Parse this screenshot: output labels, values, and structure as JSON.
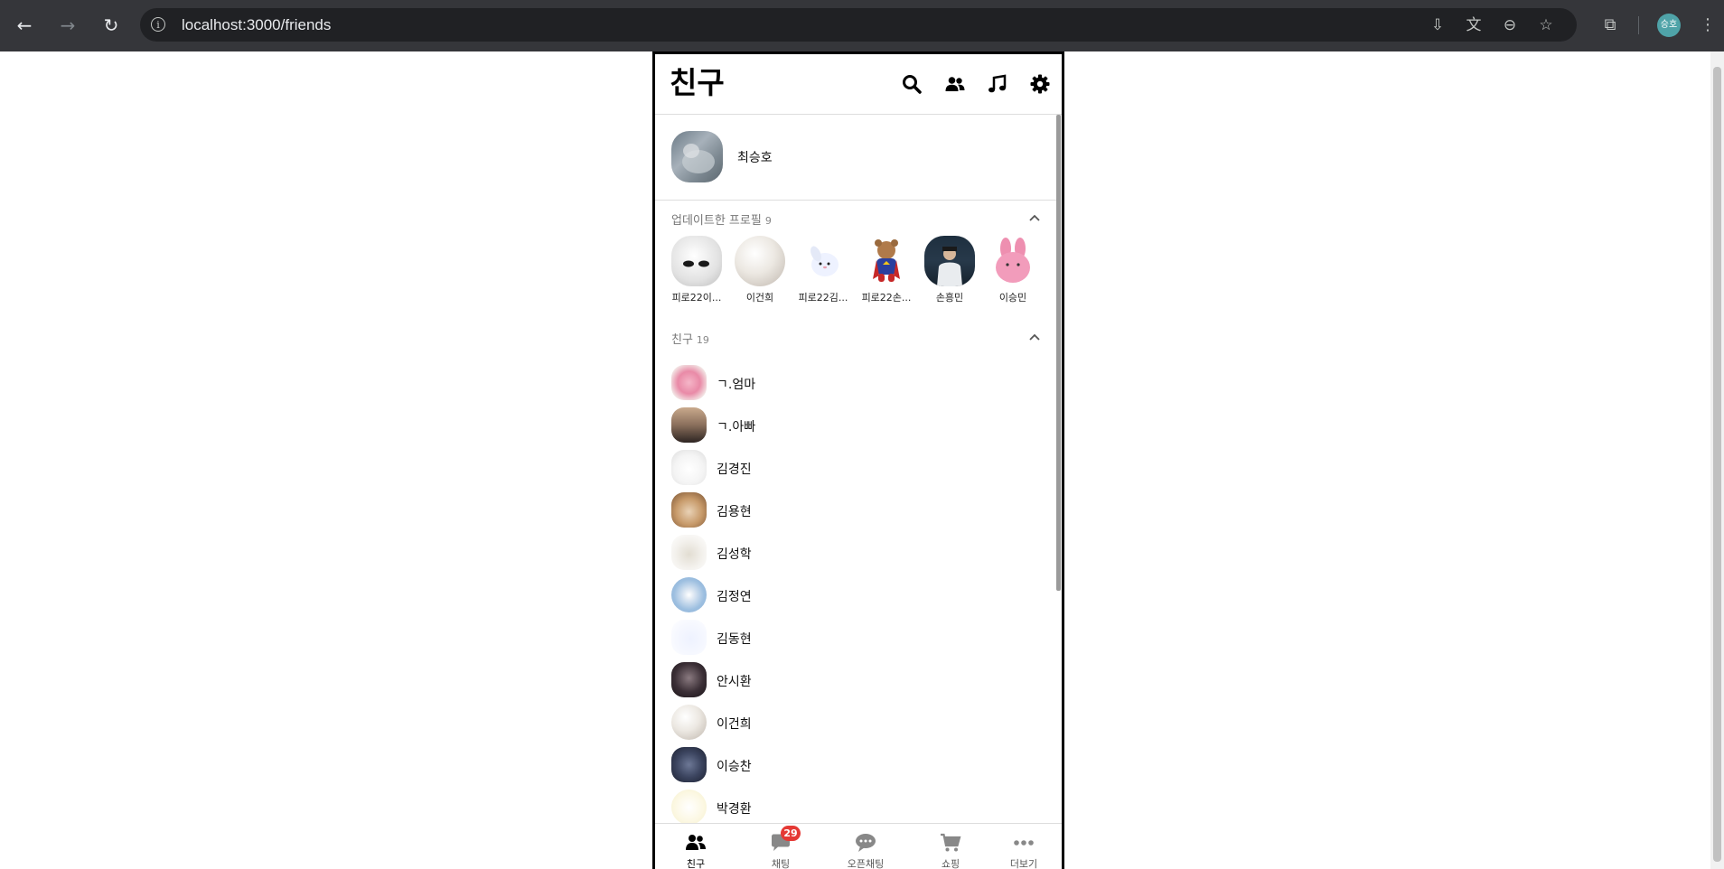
{
  "browser": {
    "url": "localhost:3000/friends",
    "profile_initials": "승호",
    "icons": [
      "back-icon",
      "forward-icon",
      "reload-icon",
      "info-icon",
      "install-icon",
      "translate-icon",
      "zoom-icon",
      "star-icon",
      "extensions-icon",
      "menu-icon"
    ]
  },
  "app": {
    "title": "친구",
    "header_icons": [
      "search-icon",
      "add-friend-icon",
      "music-icon",
      "gear-icon"
    ]
  },
  "my_profile": {
    "name": "최승호"
  },
  "updated_profiles": {
    "label": "업데이트한 프로필",
    "count": "9",
    "items": [
      {
        "name": "피로22이...",
        "avatar": "white-ball"
      },
      {
        "name": "이건희",
        "avatar": "pearl"
      },
      {
        "name": "피로22김...",
        "avatar": "white-puppy"
      },
      {
        "name": "피로22손...",
        "avatar": "teddy-bear"
      },
      {
        "name": "손흥민",
        "avatar": "person-photo"
      },
      {
        "name": "이승민",
        "avatar": "pink-bunny"
      }
    ]
  },
  "friends": {
    "label": "친구",
    "count": "19",
    "items": [
      {
        "name": "ㄱ.엄마",
        "avatar": "flowers"
      },
      {
        "name": "ㄱ.아빠",
        "avatar": "sunset"
      },
      {
        "name": "김경진",
        "avatar": "white-round"
      },
      {
        "name": "김용현",
        "avatar": "cat"
      },
      {
        "name": "김성학",
        "avatar": "white-dog"
      },
      {
        "name": "김정연",
        "avatar": "blue-circle"
      },
      {
        "name": "김동현",
        "avatar": "white-puppy"
      },
      {
        "name": "안시환",
        "avatar": "dark-portrait"
      },
      {
        "name": "이건희",
        "avatar": "pearl"
      },
      {
        "name": "이승찬",
        "avatar": "dark-landscape"
      },
      {
        "name": "박경환",
        "avatar": "pale-yellow"
      }
    ]
  },
  "bottom_nav": {
    "tabs": [
      {
        "label": "친구",
        "icon": "friends-icon",
        "active": true
      },
      {
        "label": "채팅",
        "icon": "chat-icon",
        "badge": "29"
      },
      {
        "label": "오픈채팅",
        "icon": "open-chat-icon"
      },
      {
        "label": "쇼핑",
        "icon": "cart-icon"
      },
      {
        "label": "더보기",
        "icon": "more-icon"
      }
    ]
  },
  "colors": {
    "badge": "#e53935",
    "chrome_bg": "#35363a",
    "divider": "#dddddd"
  }
}
